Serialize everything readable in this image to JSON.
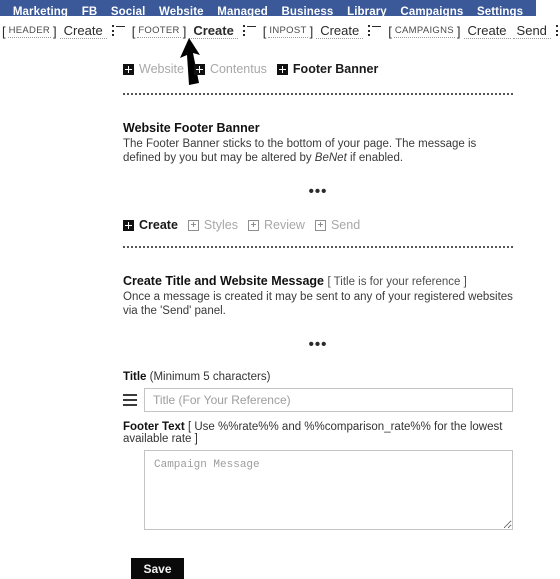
{
  "topnav": {
    "items": [
      {
        "label": "Marketing"
      },
      {
        "label": "FB"
      },
      {
        "label": "Social"
      },
      {
        "label": "Website"
      },
      {
        "label": "Managed"
      },
      {
        "label": "Business"
      },
      {
        "label": "Library"
      },
      {
        "label": "Campaigns"
      },
      {
        "label": "Settings"
      }
    ],
    "background": "#3b5998"
  },
  "breadcrumb": {
    "groups": [
      {
        "open": "[",
        "tag": "HEADER",
        "close": "]",
        "links": [
          "Create"
        ],
        "active": null,
        "list_icon": "list-icon"
      },
      {
        "open": "[",
        "tag": "FOOTER",
        "close": "]",
        "links": [
          "Create"
        ],
        "active": "Create",
        "list_icon": "list-icon"
      },
      {
        "open": "[",
        "tag": "INPOST",
        "close": "]",
        "links": [
          "Create"
        ],
        "active": null,
        "list_icon": "list-icon"
      },
      {
        "open": "[",
        "tag": "CAMPAIGNS",
        "close": "]",
        "links": [
          "Create",
          "Send"
        ],
        "active": null,
        "list_icon": "list-icon"
      }
    ]
  },
  "path_links": {
    "items": [
      {
        "label": "Website",
        "active": false
      },
      {
        "label": "Contentus",
        "active": false
      },
      {
        "label": "Footer Banner",
        "active": true
      }
    ]
  },
  "banner_section": {
    "title": "Website Footer Banner",
    "body_before": "The Footer Banner sticks to the bottom of your page. The message is defined by you but may be altered by ",
    "body_italic": "BeNet",
    "body_after": " if enabled.",
    "dots": "•••"
  },
  "steps": {
    "items": [
      {
        "label": "Create",
        "active": true
      },
      {
        "label": "Styles",
        "active": false
      },
      {
        "label": "Review",
        "active": false
      },
      {
        "label": "Send",
        "active": false
      }
    ]
  },
  "create_section": {
    "title": "Create Title and Website Message",
    "title_note": "[ Title is for your reference ]",
    "body": "Once a message is created it may be sent to any of your registered websites via the 'Send' panel.",
    "dots": "•••"
  },
  "form": {
    "title_label_bold": "Title",
    "title_label_note": "(Minimum 5 characters)",
    "title_value": "",
    "title_placeholder": "Title (For Your Reference)",
    "footer_label_bold": "Footer Text",
    "footer_label_note": "[ Use %%rate%% and %%comparison_rate%% for the lowest available rate ]",
    "footer_value": "",
    "footer_placeholder": "Campaign Message",
    "save_label": "Save"
  }
}
